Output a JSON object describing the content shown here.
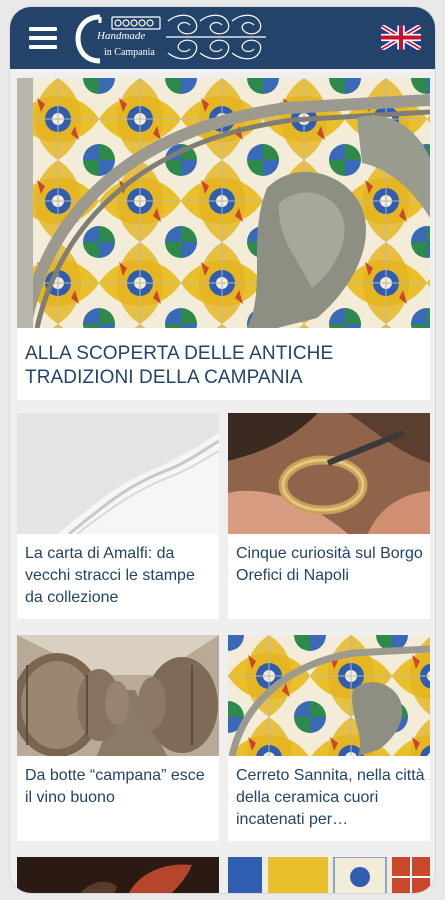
{
  "header": {
    "menu_icon": "hamburger-menu-icon",
    "logo_line1": "Handmade",
    "logo_line2": "in Campania",
    "language_flag": "uk-flag-icon"
  },
  "colors": {
    "brand_blue": "#24436b",
    "title_blue": "#24436b",
    "background": "#efefef"
  },
  "hero": {
    "title": "ALLA SCOPERTA DELLE ANTICHE TRADIZIONI DELLA CAMPANIA"
  },
  "cards": [
    {
      "title": "La carta di Amalfi: da vecchi stracci le stampe da collezione"
    },
    {
      "title": "Cinque curiosità sul Borgo Orefici di Napoli"
    },
    {
      "title": "Da botte “campana” esce il vino buono"
    },
    {
      "title": "Cerreto Sannita, nella città della ceramica cuori incatenati per…"
    }
  ]
}
